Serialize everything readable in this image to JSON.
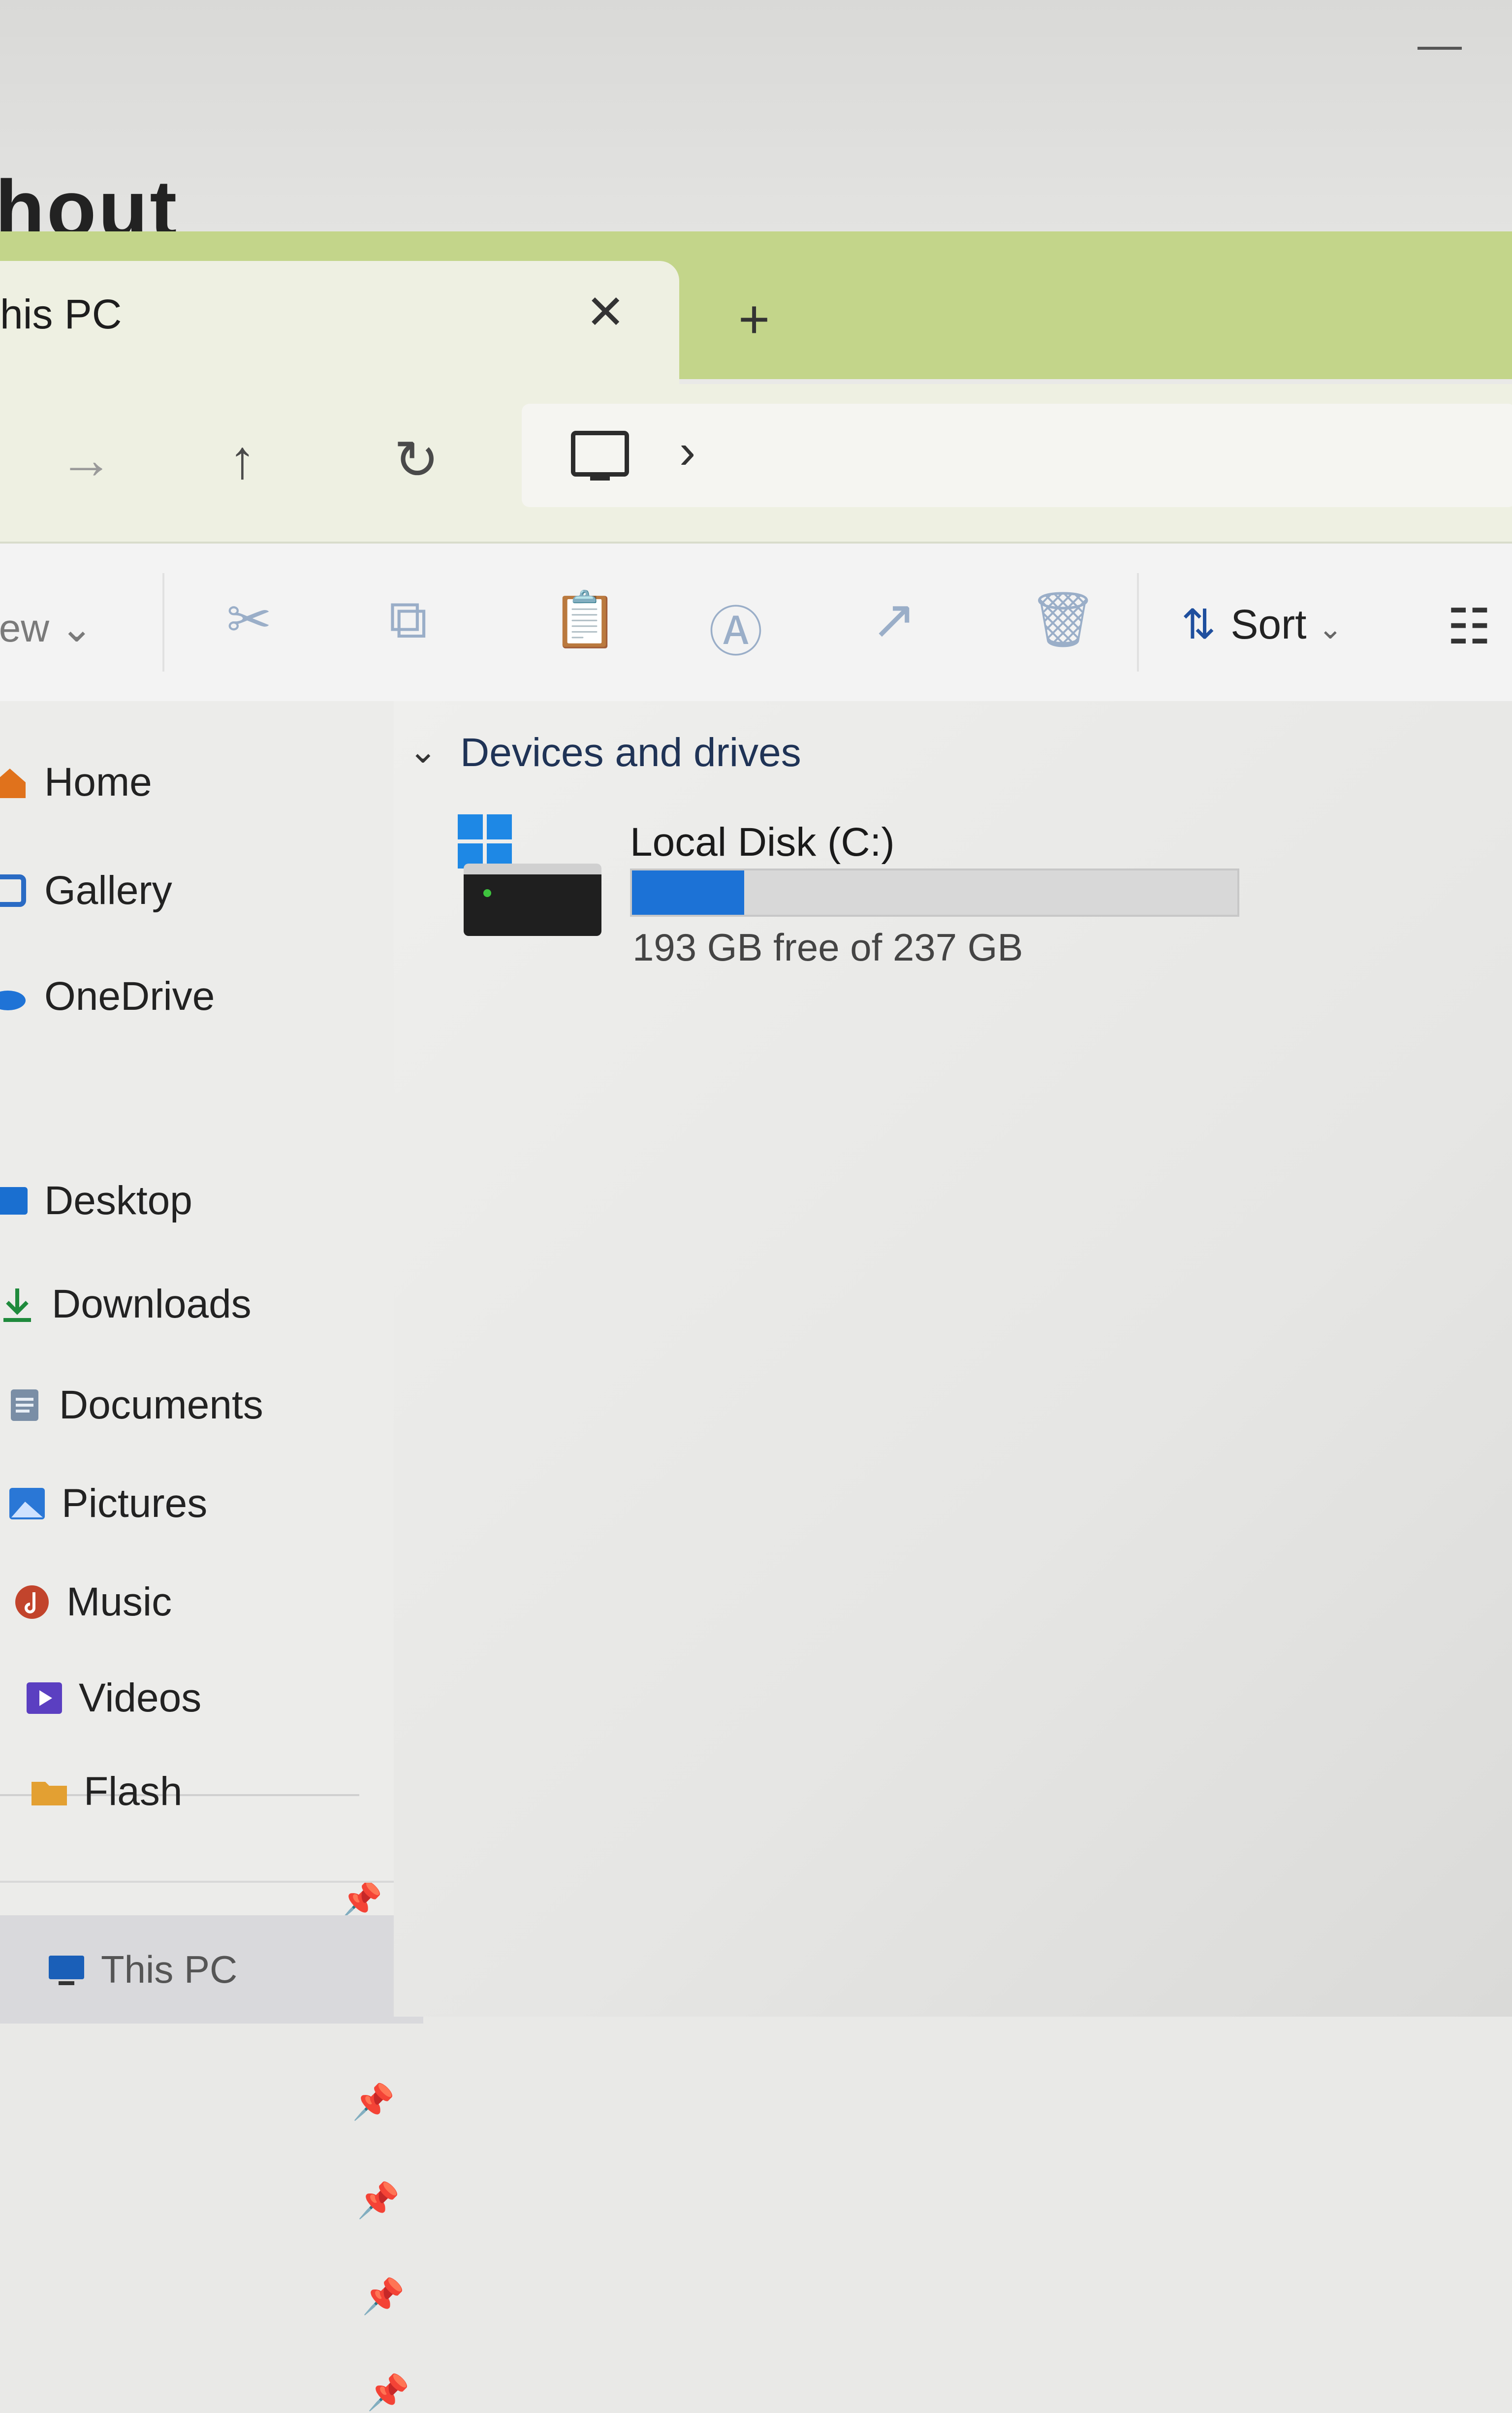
{
  "background": {
    "heading_fragment": "hout"
  },
  "tab": {
    "title": "his PC",
    "close_glyph": "✕",
    "new_tab_glyph": "+"
  },
  "nav": {
    "forward_glyph": "→",
    "up_glyph": "↑",
    "refresh_glyph": "↻",
    "address_icon": "monitor-icon",
    "address_chevron": "›"
  },
  "command_bar": {
    "new_label": "lew",
    "new_dropdown": "⌄",
    "icons": [
      "cut-icon",
      "copy-icon",
      "paste-icon",
      "rename-icon",
      "share-icon",
      "delete-icon"
    ],
    "sort_label": "Sort",
    "sort_dropdown": "⌄",
    "view_icon": "view-options-icon"
  },
  "sidebar": {
    "quick": [
      {
        "label": "Home",
        "icon": "home-icon"
      },
      {
        "label": "Gallery",
        "icon": "gallery-icon"
      },
      {
        "label": "OneDrive",
        "icon": "onedrive-icon"
      }
    ],
    "pinned": [
      {
        "label": "Desktop",
        "icon": "desktop-icon",
        "pinned": true
      },
      {
        "label": "Downloads",
        "icon": "downloads-icon",
        "pinned": true
      },
      {
        "label": "Documents",
        "icon": "documents-icon",
        "pinned": true
      },
      {
        "label": "Pictures",
        "icon": "pictures-icon",
        "pinned": true
      },
      {
        "label": "Music",
        "icon": "music-icon",
        "pinned": true
      },
      {
        "label": "Videos",
        "icon": "videos-icon",
        "pinned": true
      },
      {
        "label": "Flash",
        "icon": "folder-icon",
        "pinned": false
      }
    ],
    "this_pc": {
      "label": "This PC",
      "icon": "this-pc-icon"
    },
    "pin_glyph": "📌"
  },
  "content": {
    "section_chevron": "⌄",
    "section_title": "Devices and drives",
    "drives": [
      {
        "name": "Local Disk (C:)",
        "free_text": "193 GB free of 237 GB",
        "used_fraction": 0.1857
      }
    ]
  },
  "colors": {
    "accent_titlebar": "#c3d58a",
    "drive_bar_fill": "#1c72d6",
    "section_title": "#1f3356"
  }
}
